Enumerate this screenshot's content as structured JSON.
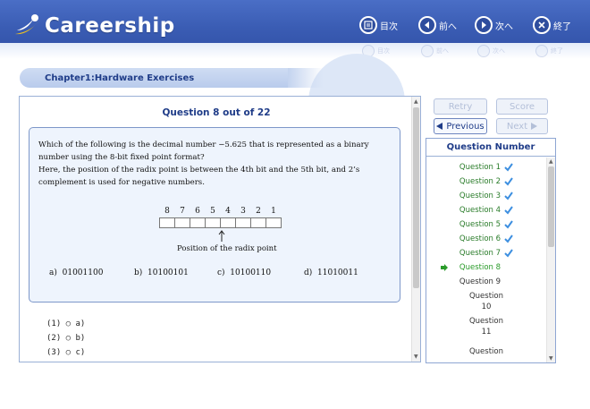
{
  "app": {
    "title": "Careership"
  },
  "topnav": {
    "contents": {
      "label": "目次",
      "icon": "contents-icon"
    },
    "prev": {
      "label": "前へ",
      "icon": "arrow-left-icon"
    },
    "next": {
      "label": "次へ",
      "icon": "arrow-right-icon"
    },
    "exit": {
      "label": "終了",
      "icon": "close-icon"
    }
  },
  "chapter": {
    "title": "Chapter1:Hardware   Exercises"
  },
  "question": {
    "header": "Question 8 out of 22",
    "text1": "Which of the following is the decimal number −5.625 that is represented as a binary number using the 8-bit fixed point format?",
    "text2": "Here, the position of the radix point is between the 4th bit and the 5th bit, and 2’s complement is used for negative numbers.",
    "bit_numbers": [
      "8",
      "7",
      "6",
      "5",
      "4",
      "3",
      "2",
      "1"
    ],
    "radix_label": "Position of the radix point",
    "choices": [
      {
        "key": "a)",
        "value": "01001100"
      },
      {
        "key": "b)",
        "value": "10100101"
      },
      {
        "key": "c)",
        "value": "10100110"
      },
      {
        "key": "d)",
        "value": "11010011"
      }
    ]
  },
  "answers": [
    {
      "label": "(1) ○ a)"
    },
    {
      "label": "(2) ○ b)"
    },
    {
      "label": "(3) ○ c)"
    }
  ],
  "buttons": {
    "retry": "Retry",
    "score": "Score",
    "previous": "Previous",
    "next": "Next"
  },
  "question_panel": {
    "header": "Question Number",
    "items": [
      {
        "label": "Question 1",
        "status": "answered"
      },
      {
        "label": "Question 2",
        "status": "answered"
      },
      {
        "label": "Question 3",
        "status": "answered"
      },
      {
        "label": "Question 4",
        "status": "answered"
      },
      {
        "label": "Question 5",
        "status": "answered"
      },
      {
        "label": "Question 6",
        "status": "answered"
      },
      {
        "label": "Question 7",
        "status": "answered"
      },
      {
        "label": "Question 8",
        "status": "current"
      },
      {
        "label": "Question 9",
        "status": "unanswered"
      }
    ],
    "wrapped": [
      {
        "line1": "Question",
        "line2": "10"
      },
      {
        "line1": "Question",
        "line2": "11"
      },
      {
        "line1": "Question",
        "line2": ""
      }
    ]
  },
  "colors": {
    "brand": "#3a5cb3",
    "accent_text": "#1f3c88",
    "answered_text": "#2a7c2a",
    "check": "#3d8fe0"
  }
}
